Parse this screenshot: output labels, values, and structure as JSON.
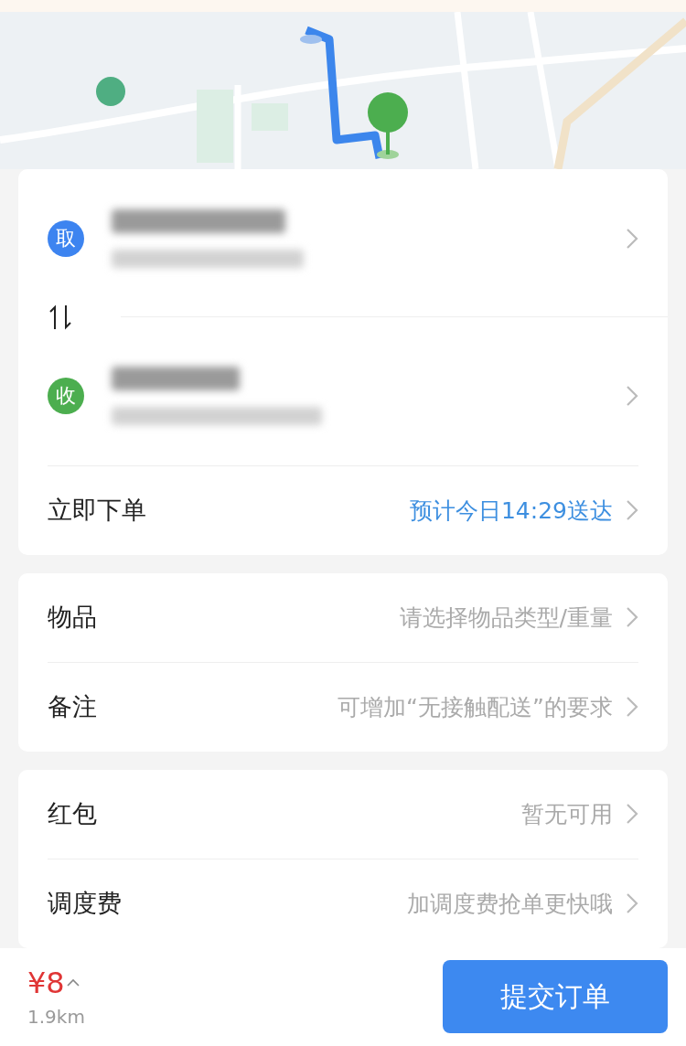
{
  "route": {
    "stops": [
      {
        "badge": "取",
        "color": "#3d84f0"
      },
      {
        "badge": "收",
        "color": "#4cae4f"
      }
    ],
    "schedule": {
      "label": "立即下单",
      "value": "预计今日14:29送达"
    }
  },
  "details": [
    {
      "label": "物品",
      "hint": "请选择物品类型/重量"
    },
    {
      "label": "备注",
      "hint": "可增加“无接触配送”的要求"
    }
  ],
  "extras": [
    {
      "label": "红包",
      "hint": "暂无可用"
    },
    {
      "label": "调度费",
      "hint": "加调度费抢单更快哦"
    }
  ],
  "footer": {
    "price": "¥8",
    "distance": "1.9km",
    "submit": "提交订单"
  }
}
